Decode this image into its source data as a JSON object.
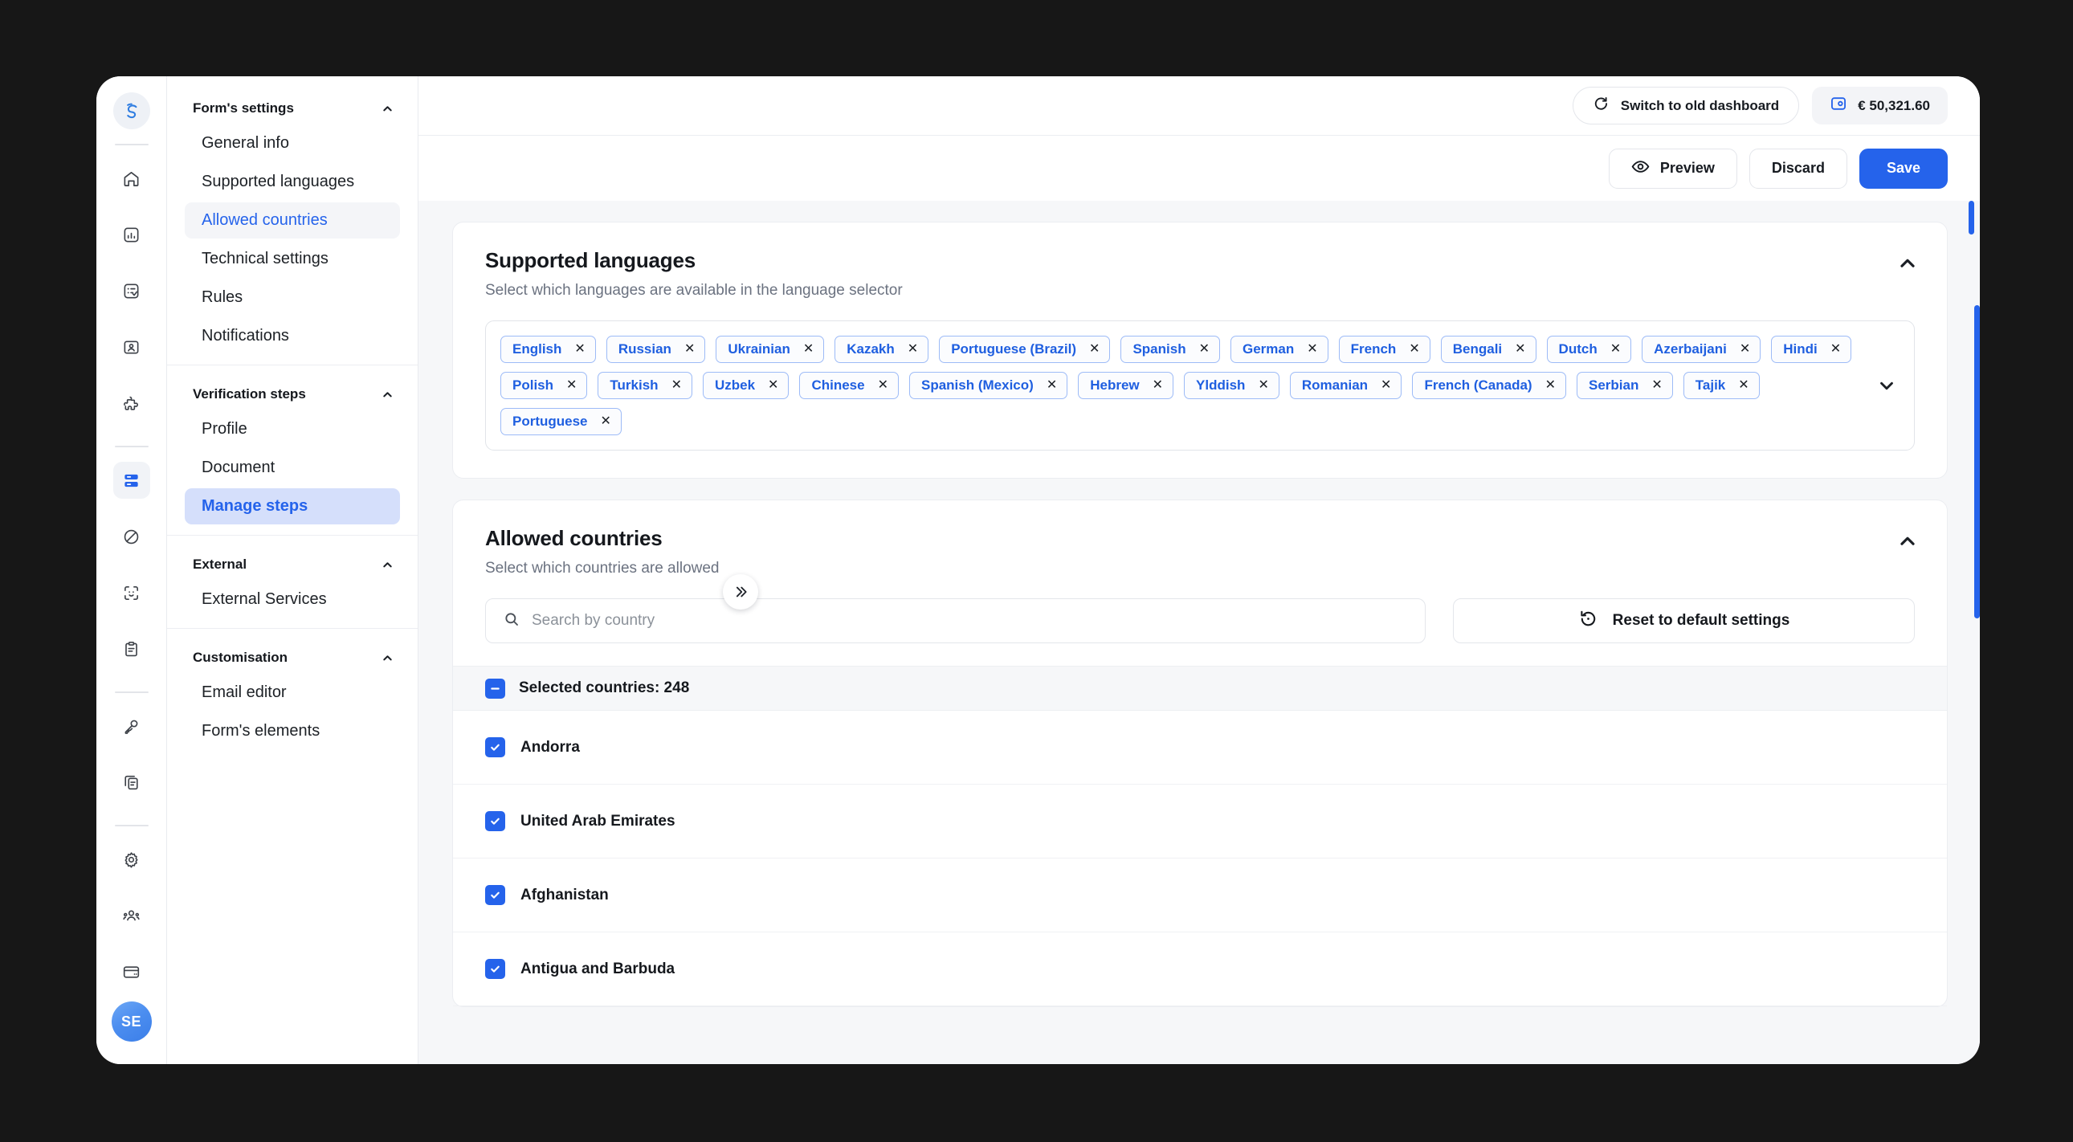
{
  "rail": {
    "logo_icon": "swirl-logo-icon",
    "top_icons": [
      {
        "name": "home-icon",
        "active": false
      },
      {
        "name": "analytics-icon",
        "active": false
      },
      {
        "name": "checklist-icon",
        "active": false
      },
      {
        "name": "id-card-icon",
        "active": false
      },
      {
        "name": "puzzle-icon",
        "active": false
      }
    ],
    "mid_icons": [
      {
        "name": "forms-icon",
        "active": true
      },
      {
        "name": "blocked-icon",
        "active": false
      },
      {
        "name": "face-scan-icon",
        "active": false
      },
      {
        "name": "clipboard-icon",
        "active": false
      }
    ],
    "bottom_icons": [
      {
        "name": "key-icon",
        "active": false
      },
      {
        "name": "copy-document-icon",
        "active": false
      }
    ],
    "util_icons": [
      {
        "name": "gear-icon",
        "active": false
      },
      {
        "name": "team-icon",
        "active": false
      },
      {
        "name": "card-icon",
        "active": false
      }
    ],
    "avatar_initials": "SE"
  },
  "sidebar": {
    "collapse_icon": "chevron-double-right-icon",
    "groups": [
      {
        "title": "Form's settings",
        "chevron": "chevron-up-icon",
        "items": [
          {
            "label": "General info",
            "state": "normal"
          },
          {
            "label": "Supported languages",
            "state": "normal"
          },
          {
            "label": "Allowed countries",
            "state": "selected-soft"
          },
          {
            "label": "Technical settings",
            "state": "normal"
          },
          {
            "label": "Rules",
            "state": "normal"
          },
          {
            "label": "Notifications",
            "state": "normal"
          }
        ]
      },
      {
        "title": "Verification steps",
        "chevron": "chevron-up-icon",
        "items": [
          {
            "label": "Profile",
            "state": "normal"
          },
          {
            "label": "Document",
            "state": "normal"
          },
          {
            "label": "Manage steps",
            "state": "selected-strong"
          }
        ]
      },
      {
        "title": "External",
        "chevron": "chevron-up-icon",
        "items": [
          {
            "label": "External Services",
            "state": "normal"
          }
        ]
      },
      {
        "title": "Customisation",
        "chevron": "chevron-up-icon",
        "items": [
          {
            "label": "Email editor",
            "state": "normal"
          },
          {
            "label": "Form's elements",
            "state": "normal"
          }
        ]
      }
    ]
  },
  "topbar": {
    "switch_dashboard_label": "Switch to old dashboard",
    "switch_dashboard_icon": "refresh-icon",
    "balance_icon": "wallet-icon",
    "balance_value": "€ 50,321.60"
  },
  "actionbar": {
    "preview_label": "Preview",
    "preview_icon": "eye-icon",
    "discard_label": "Discard",
    "save_label": "Save"
  },
  "languages_card": {
    "title": "Supported languages",
    "subtitle": "Select which languages are available in the language selector",
    "collapse_icon": "chevron-up-icon",
    "expand_icon": "chevron-down-icon",
    "tags": [
      "English",
      "Russian",
      "Ukrainian",
      "Kazakh",
      "Portuguese (Brazil)",
      "Spanish",
      "German",
      "French",
      "Bengali",
      "Dutch",
      "Azerbaijani",
      "Hindi",
      "Polish",
      "Turkish",
      "Uzbek",
      "Chinese",
      "Spanish (Mexico)",
      "Hebrew",
      "Ylddish",
      "Romanian",
      "French (Canada)",
      "Serbian",
      "Tajik",
      "Portuguese"
    ],
    "remove_glyph": "✕"
  },
  "countries_card": {
    "title": "Allowed countries",
    "subtitle": "Select which countries are allowed",
    "collapse_icon": "chevron-up-icon",
    "search_placeholder": "Search by country",
    "search_value": "",
    "search_icon": "search-icon",
    "reset_label": "Reset to default settings",
    "reset_icon": "history-reset-icon",
    "selected_label": "Selected countries: 248",
    "rows": [
      {
        "label": "Andorra",
        "checked": true
      },
      {
        "label": "United Arab Emirates",
        "checked": true
      },
      {
        "label": "Afghanistan",
        "checked": true
      },
      {
        "label": "Antigua and Barbuda",
        "checked": true
      }
    ]
  },
  "colors": {
    "accent": "#2563eb",
    "tag_border": "#9dbbf7",
    "page_bg": "#f6f7f9",
    "desktop_bg": "#171717"
  }
}
